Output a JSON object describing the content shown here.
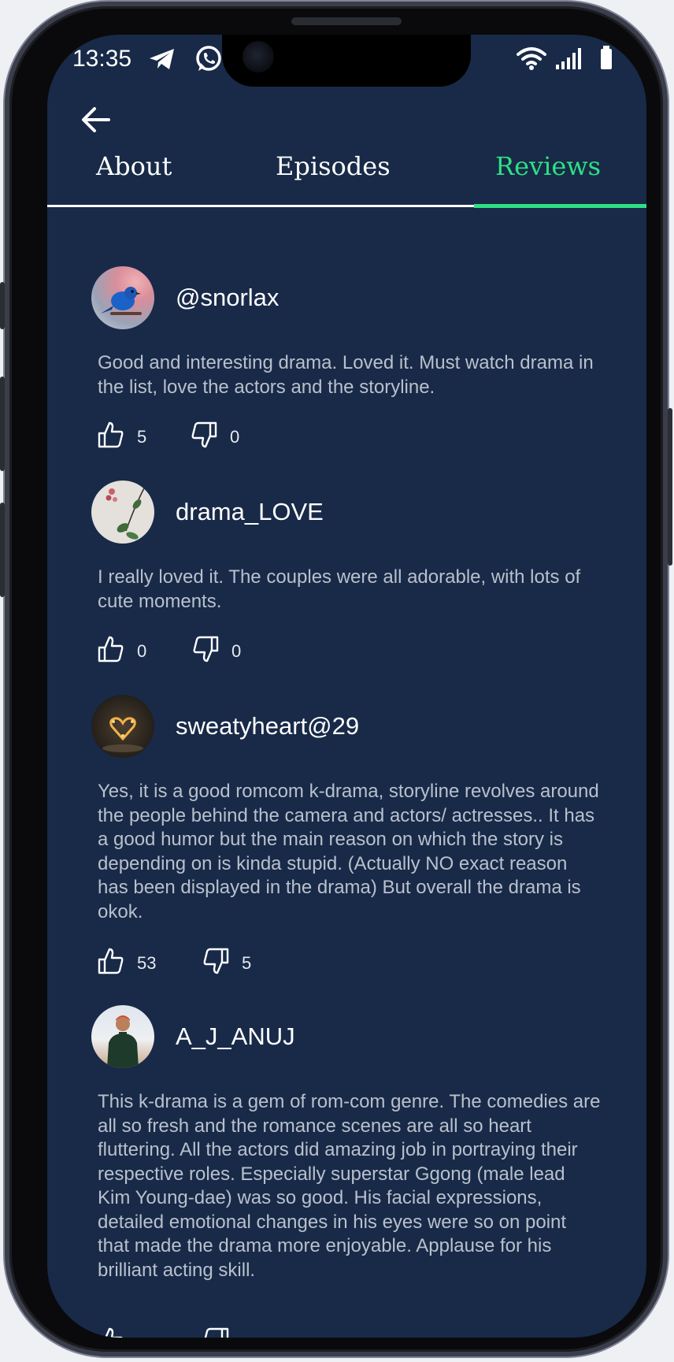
{
  "status_bar": {
    "time": "13:35"
  },
  "tabs": [
    {
      "label": "About",
      "active": false
    },
    {
      "label": "Episodes",
      "active": false
    },
    {
      "label": "Reviews",
      "active": true
    }
  ],
  "colors": {
    "background": "#182a48",
    "accent": "#2ee084",
    "text_secondary": "#b9c0cc"
  },
  "reviews": [
    {
      "username": "@snorlax",
      "text": "Good and interesting drama. Loved it. Must watch drama in the list, love the actors and the storyline.",
      "likes": "5",
      "dislikes": "0"
    },
    {
      "username": "drama_LOVE",
      "text": "I really loved it. The couples were all adorable, with lots of cute moments.",
      "likes": "0",
      "dislikes": "0"
    },
    {
      "username": "sweatyheart@29",
      "text": "Yes, it is a good romcom k-drama, storyline revolves around the people behind the camera and actors/ actresses.. It has a good humor but the main reason on which the story is depending on is kinda stupid. (Actually NO exact reason has been displayed in the drama) But overall the drama is okok.",
      "likes": "53",
      "dislikes": "5"
    },
    {
      "username": "A_J_ANUJ",
      "text": "This k-drama is a gem of rom-com genre. The comedies are all so fresh and the romance scenes are all so heart fluttering. All the actors did amazing job in portraying their respective roles. Especially superstar Ggong (male lead Kim Young-dae) was so good. His facial expressions, detailed emotional changes in his eyes were so on point that made the drama more enjoyable. Applause for his brilliant acting skill.",
      "likes": "",
      "dislikes": ""
    }
  ]
}
